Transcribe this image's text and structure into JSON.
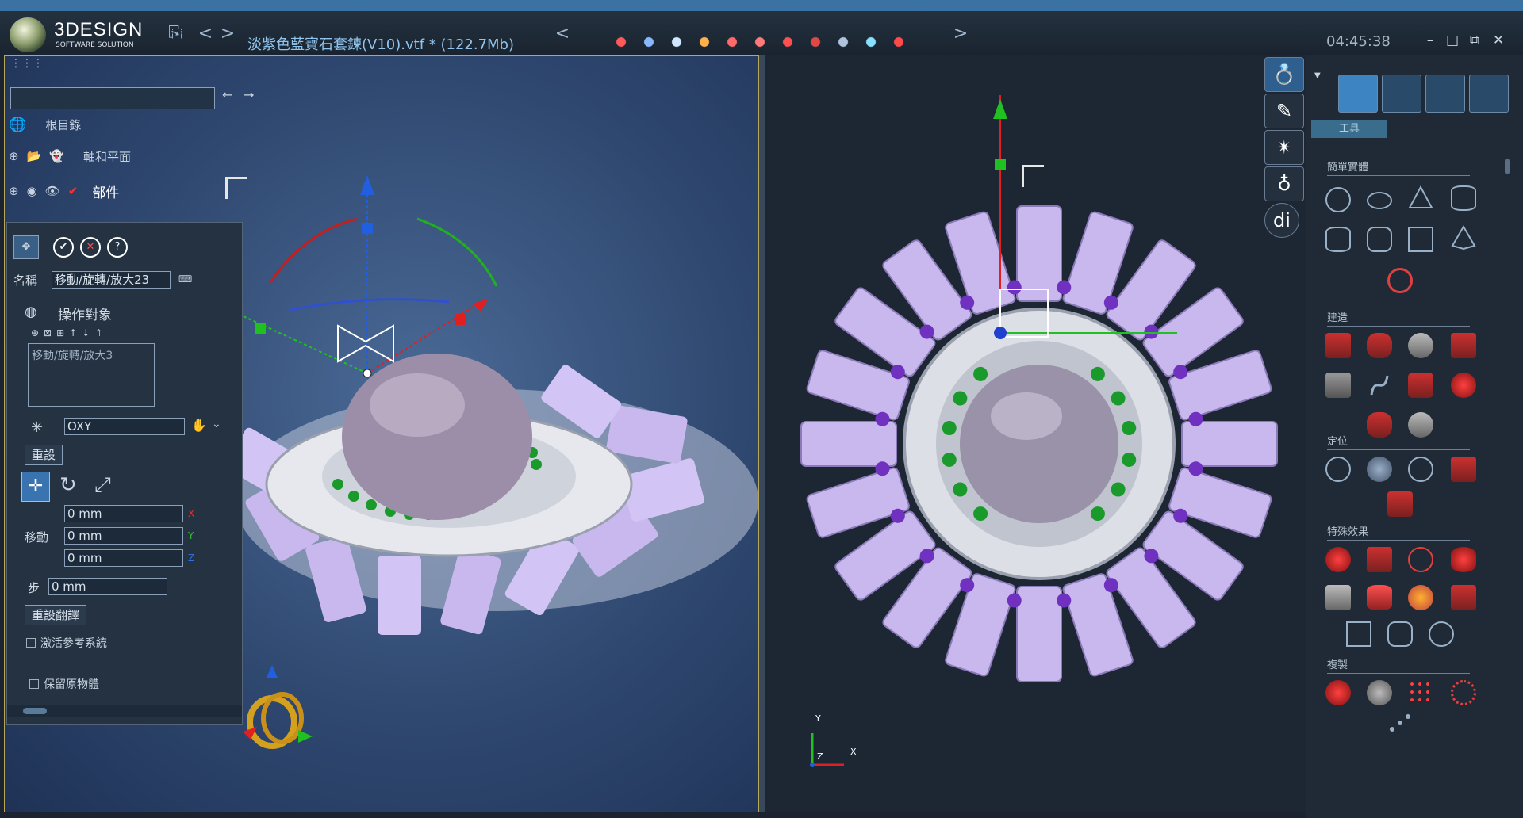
{
  "titlebar": {
    "brand": "3DESIGN",
    "brand_sub": "SOFTWARE SOLUTION",
    "file_title": "淡紫色藍寶石套鍊(V10).vtf * (122.7Mb)",
    "clock": "04:45:38",
    "nav_prev": "<",
    "nav_next": ">",
    "scroll_left": "<",
    "scroll_right": ">",
    "min": "–",
    "max": "□",
    "restore": "⧉",
    "close": "✕"
  },
  "tree": {
    "root_label": "根目錄",
    "axis_label": "軸和平面",
    "parts_label": "部件",
    "back": "←",
    "forward": "→"
  },
  "transform_panel": {
    "name_label": "名稱",
    "name_value": "移動/旋轉/放大23",
    "target_header": "操作對象",
    "target_item": "移動/旋轉/放大3",
    "plane_value": "OXY",
    "reset_label": "重設",
    "move_label": "移動",
    "move_x": "0 mm",
    "move_y": "0 mm",
    "move_z": "0 mm",
    "axis_x": "X",
    "axis_y": "Y",
    "axis_z": "Z",
    "step_label": "步",
    "step_value": "0 mm",
    "reset_translate": "重設翻譯",
    "activate_ref": "激活參考系統",
    "keep_original": "保留原物體",
    "help": "?"
  },
  "right_panel": {
    "mode_tab": "工具",
    "sections": {
      "simple": "簡單實體",
      "build": "建造",
      "position": "定位",
      "effects": "特殊效果",
      "copy": "複製"
    }
  },
  "viewport_right": {
    "axis_x": "X",
    "axis_y": "Y",
    "axis_z": "Z"
  },
  "colors": {
    "accent": "#3d84c2",
    "gizmo_x": "#e02020",
    "gizmo_y": "#20c020",
    "gizmo_z": "#2060e0"
  }
}
